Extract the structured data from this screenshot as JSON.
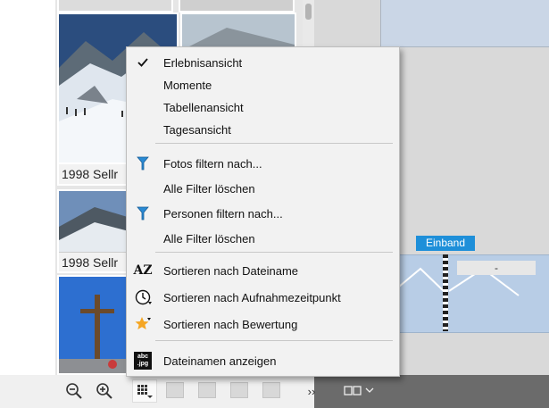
{
  "photos": [
    {
      "caption": ""
    },
    {
      "caption": ""
    },
    {
      "caption": "1998 Sellr"
    },
    {
      "caption": "1998 Sellr"
    },
    {
      "caption": ""
    }
  ],
  "menu": {
    "views": [
      {
        "label": "Erlebnisansicht",
        "checked": true
      },
      {
        "label": "Momente",
        "checked": false
      },
      {
        "label": "Tabellenansicht",
        "checked": false
      },
      {
        "label": "Tagesansicht",
        "checked": false
      }
    ],
    "filter_photos": "Fotos filtern nach...",
    "clear_filters_1": "Alle Filter löschen",
    "filter_persons": "Personen filtern nach...",
    "clear_filters_2": "Alle Filter löschen",
    "sort_name": "Sortieren nach Dateiname",
    "sort_name_icon_text": "AZ",
    "sort_time": "Sortieren nach Aufnahmezeitpunkt",
    "sort_rating": "Sortieren nach Bewertung",
    "show_filenames": "Dateinamen anzeigen",
    "filenames_icon_text": [
      "abc",
      ".jpg"
    ]
  },
  "editor": {
    "section_label": "Einband",
    "cover_field": "-"
  },
  "toolbar": {
    "more": "››"
  },
  "colors": {
    "accent": "#1e8fd9",
    "filter_icon": "#2a8ad4",
    "rating_star": "#f5a623"
  },
  "icons": [
    "check-icon",
    "filter-funnel-icon",
    "sort-az-icon",
    "clock-icon",
    "star-icon",
    "filename-icon",
    "zoom-out-icon",
    "zoom-in-icon",
    "grid-view-icon",
    "layout-icon",
    "chevron-down-icon"
  ]
}
